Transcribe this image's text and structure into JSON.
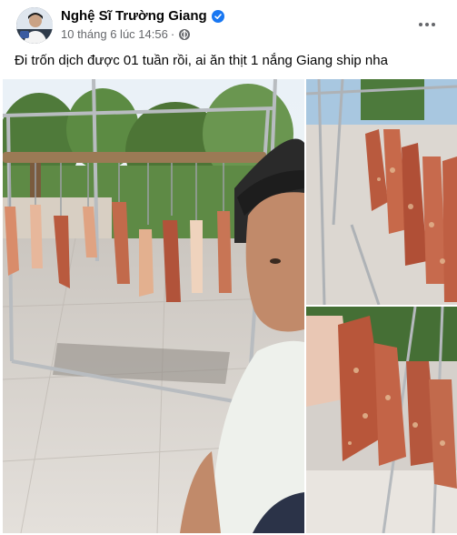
{
  "post": {
    "author": "Nghệ Sĩ Trường Giang",
    "timestamp": "10 tháng 6 lúc 14:56",
    "separator": "·",
    "caption": "Đi trốn dịch được 01 tuần rồi, ai ăn thịt 1 nắng Giang ship nha",
    "icons": {
      "verified": "verified-badge-icon",
      "audience": "globe-icon",
      "menu": "more-options-icon"
    },
    "colors": {
      "accent": "#1877f2",
      "secondary_text": "#65676b",
      "primary_text": "#050505"
    }
  }
}
